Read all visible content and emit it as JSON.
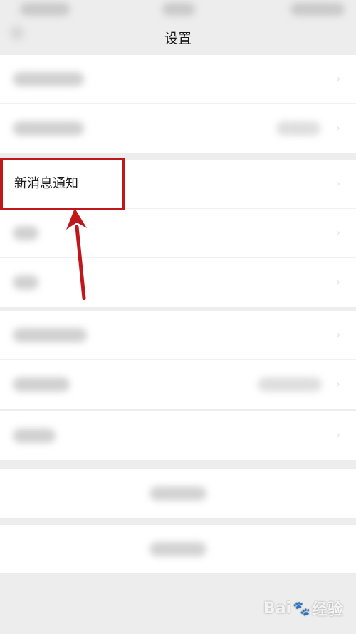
{
  "header": {
    "title": "设置"
  },
  "notifications_row": {
    "label": "新消息通知"
  },
  "watermark": {
    "text_left": "Bai",
    "text_right": "经验",
    "paw_icon": "paw-icon"
  },
  "colors": {
    "highlight": "#c0171a",
    "background": "#ededed",
    "row_bg": "#ffffff"
  }
}
